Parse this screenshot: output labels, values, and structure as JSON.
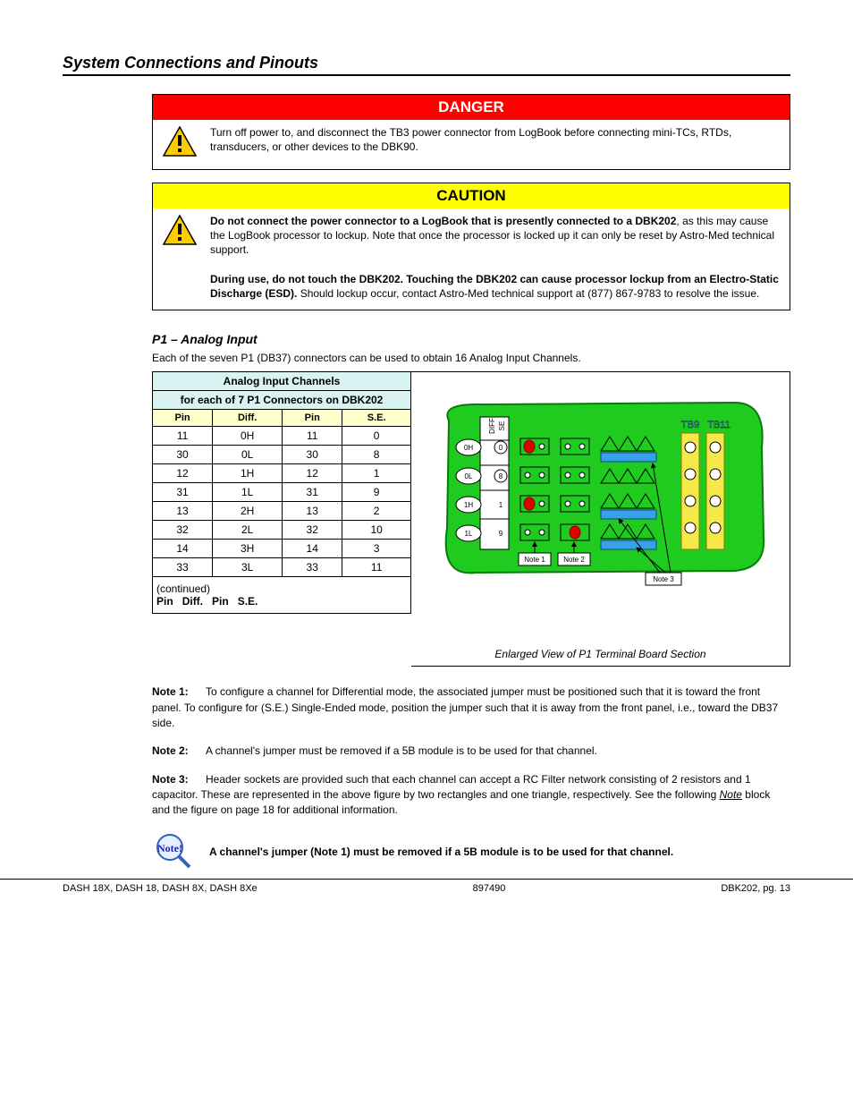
{
  "section_title": "System Connections and Pinouts",
  "danger": {
    "header": "DANGER",
    "text": "Turn off power to, and disconnect the TB3 power connector from LogBook before connecting mini-TCs, RTDs, transducers, or other devices to the DBK90."
  },
  "caution": {
    "header": "CAUTION",
    "bold1": "Do not connect the power connector to a LogBook that is presently connected to a DBK202",
    "text1": ", as this may cause the LogBook processor to lockup. Note that once the processor is locked up it can only be reset by Astro-Med technical support.",
    "bold2": "During use, do not touch the DBK202. Touching the DBK202 can cause processor lockup from an Electro-Static Discharge (ESD).",
    "text2": " Should lockup occur, contact Astro-Med technical support at (877) 867-9783 to resolve the issue."
  },
  "subtitle": "P1 – Analog Input",
  "intro": "Each of the seven P1 (DB37) connectors can be used to obtain 16 Analog Input Channels.",
  "table": {
    "top_row1": "Analog Input Channels",
    "top_row2": "for each of 7 P1 Connectors on DBK202",
    "heads": [
      "Pin",
      "Diff.",
      "Pin",
      "S.E."
    ],
    "rows": [
      [
        "11",
        "0H",
        "11",
        "0"
      ],
      [
        "30",
        "0L",
        "30",
        "8"
      ],
      [
        "12",
        "1H",
        "12",
        "1"
      ],
      [
        "31",
        "1L",
        "31",
        "9"
      ],
      [
        "13",
        "2H",
        "13",
        "2"
      ],
      [
        "32",
        "2L",
        "32",
        "10"
      ],
      [
        "14",
        "3H",
        "14",
        "3"
      ],
      [
        "33",
        "3L",
        "33",
        "11"
      ]
    ],
    "cont_cell": "(continued)",
    "cont_heads": [
      "Pin",
      "Diff.",
      "Pin",
      "S.E."
    ]
  },
  "figure_caption": "Enlarged View of P1 Terminal Board Section",
  "fig_labels": {
    "diff": "DIFF",
    "se": "SE",
    "tb9": "TB9",
    "tb11": "TB11",
    "n1": "Note 1",
    "n2": "Note 2",
    "n3": "Note 3"
  },
  "notes": {
    "n1": {
      "label": "Note 1:",
      "text": "To configure a channel for Differential mode, the associated jumper must be positioned such that it is toward the front panel. To configure for (S.E.) Single-Ended mode, position the jumper such that it is away from the front panel, i.e., toward the DB37 side."
    },
    "n2": {
      "label": "Note 2:",
      "text": "A channel's jumper must be removed if a 5B module is to be used for that channel."
    },
    "n3": {
      "label": "Note 3:",
      "text": "Header sockets are provided such that each channel can accept a RC Filter network consisting of 2 resistors and 1 capacitor. These are represented in the above figure by two rectangles and one triangle, respectively. See the following ",
      "em": "Note",
      "text2": " block and the figure on page 18 for additional information."
    }
  },
  "noteblock": "A channel's jumper (Note 1) must be removed if a 5B module is to be used for that channel.",
  "footer": {
    "left": "DASH 18X, DASH 18, DASH 8X, DASH 8Xe",
    "center": "897490",
    "right": "DBK202, pg. 13"
  }
}
